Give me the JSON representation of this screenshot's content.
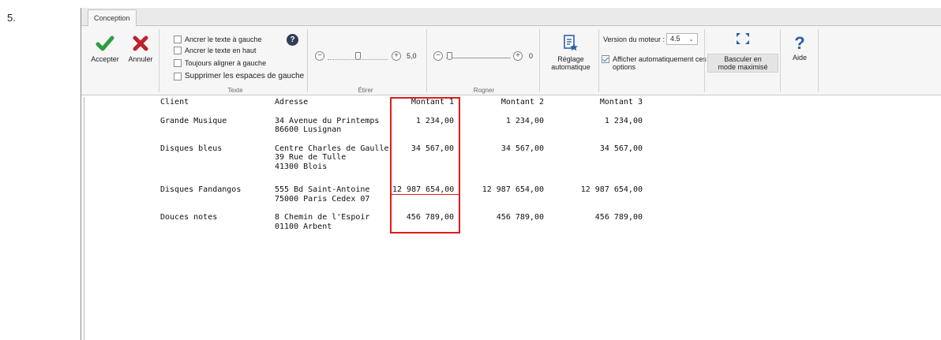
{
  "step_number": "5.",
  "tab": {
    "label": "Conception"
  },
  "ribbon": {
    "accept_label": "Accepter",
    "cancel_label": "Annuler",
    "text_group": {
      "label": "Texte",
      "options": [
        {
          "label": "Ancrer le texte à gauche",
          "checked": false
        },
        {
          "label": "Ancrer le texte en haut",
          "checked": false
        },
        {
          "label": "Toujours aligner à gauche",
          "checked": false
        },
        {
          "label": "Supprimer les espaces de gauche",
          "checked": false
        }
      ],
      "help": "?"
    },
    "stretch_group": {
      "label": "Étirer",
      "value": "5,0",
      "minus": "−",
      "plus": "+"
    },
    "crop_group": {
      "label": "Rogner",
      "value": "0",
      "minus": "−",
      "plus": "+"
    },
    "auto_adjust": {
      "line1": "Réglage",
      "line2": "automatique"
    },
    "engine": {
      "label": "Version du moteur :",
      "value": "4.5",
      "auto_options_line1": "Afficher automatiquement ces",
      "auto_options_line2": "options",
      "auto_options_checked": true
    },
    "maximize": {
      "line1": "Basculer en",
      "line2": "mode maximisé"
    },
    "help": {
      "label": "Aide",
      "glyph": "?"
    }
  },
  "table": {
    "headers": [
      "Client",
      "Adresse",
      "Montant 1",
      "Montant 2",
      "Montant 3"
    ],
    "rows": [
      {
        "client": "Grande Musique",
        "address": [
          "34 Avenue du Printemps",
          "86600 Lusignan"
        ],
        "m1": "1 234,00",
        "m2": "1 234,00",
        "m3": "1 234,00"
      },
      {
        "client": "Disques bleus",
        "address": [
          "Centre Charles de Gaulle",
          "39 Rue de Tulle",
          "41300 Blois"
        ],
        "m1": "34 567,00",
        "m2": "34 567,00",
        "m3": "34 567,00"
      },
      {
        "client": "Disques Fandangos",
        "address": [
          "555 Bd Saint-Antoine",
          "75000 Paris Cedex 07"
        ],
        "m1": "12 987 654,00",
        "m2": "12 987 654,00",
        "m3": "12 987 654,00"
      },
      {
        "client": "Douces notes",
        "address": [
          "8 Chemin de l'Espoir",
          "01100 Arbent"
        ],
        "m1": "456 789,00",
        "m2": "456 789,00",
        "m3": "456 789,00"
      }
    ]
  },
  "colors": {
    "highlight": "#e01b1b",
    "accept": "#2e9e3e",
    "cancel": "#c0202b",
    "accent": "#2a5fa8"
  }
}
